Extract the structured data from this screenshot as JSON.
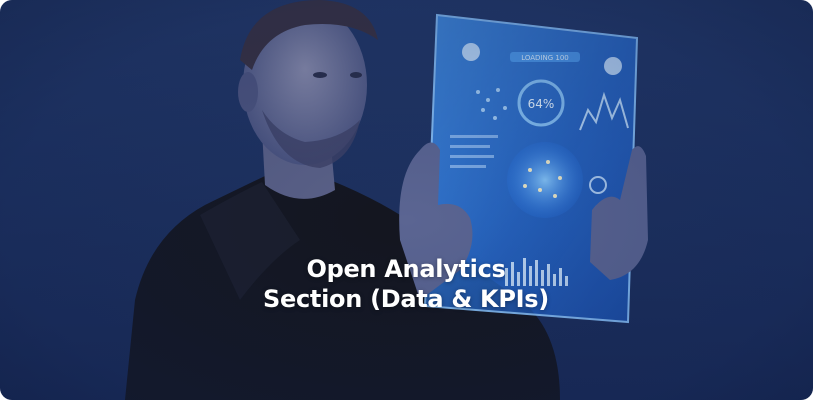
{
  "card": {
    "title": "Open Analytics Section (Data & KPIs)"
  },
  "tablet_screen": {
    "header_label": "LOADING 100",
    "gauge_value": "64%"
  },
  "colors": {
    "background": "#1e3260",
    "tablet_glow": "#3c8cff",
    "title_text": "#ffffff"
  }
}
